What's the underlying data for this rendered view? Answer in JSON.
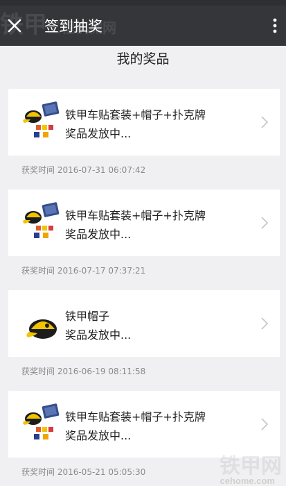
{
  "header": {
    "title": "签到抽奖",
    "watermark": "铁甲工程机械网 cehome.com"
  },
  "section": {
    "title": "我的奖品"
  },
  "prizes": [
    {
      "name": "铁甲车贴套装+帽子+扑克牌",
      "status": "奖品发放中...",
      "time": "获奖时间 2016-07-31 06:07:42",
      "image": "cap-stickers-cards-icon"
    },
    {
      "name": "铁甲车贴套装+帽子+扑克牌",
      "status": "奖品发放中...",
      "time": "获奖时间 2016-07-17 07:37:21",
      "image": "cap-stickers-cards-icon"
    },
    {
      "name": "铁甲帽子",
      "status": "奖品发放中...",
      "time": "获奖时间 2016-06-19 08:11:58",
      "image": "cap-icon"
    },
    {
      "name": "铁甲车贴套装+帽子+扑克牌",
      "status": "奖品发放中...",
      "time": "获奖时间 2016-05-21 05:05:30",
      "image": "cap-stickers-cards-icon"
    }
  ],
  "footer_watermark": {
    "text": "铁甲网",
    "url": "cehome.com"
  },
  "colors": {
    "topbar": "#35363a",
    "background": "#f0f0f2",
    "card": "#ffffff",
    "time_text": "#8a8a8a"
  }
}
